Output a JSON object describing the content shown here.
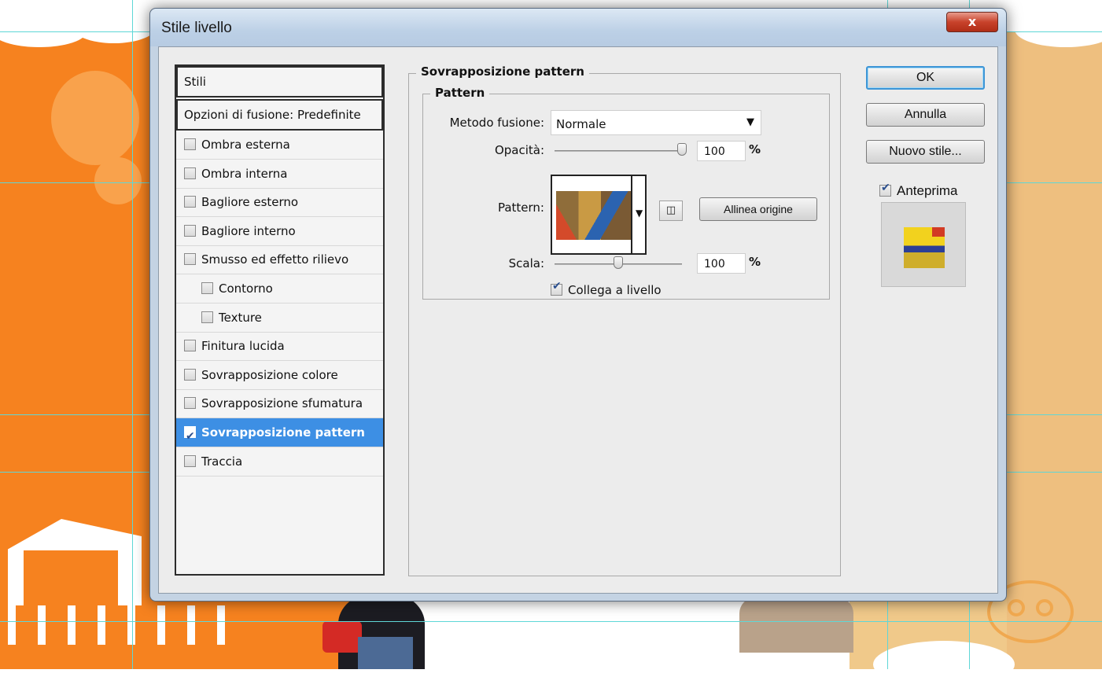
{
  "dialog": {
    "title": "Stile livello",
    "close_label": "x"
  },
  "styles_panel": {
    "header": "Stili",
    "blend_options": "Opzioni di fusione: Predefinite",
    "items": [
      {
        "label": "Ombra esterna",
        "checked": false
      },
      {
        "label": "Ombra interna",
        "checked": false
      },
      {
        "label": "Bagliore esterno",
        "checked": false
      },
      {
        "label": "Bagliore interno",
        "checked": false
      },
      {
        "label": "Smusso ed effetto rilievo",
        "checked": false
      },
      {
        "label": "Contorno",
        "checked": false,
        "sub": true
      },
      {
        "label": "Texture",
        "checked": false,
        "sub": true
      },
      {
        "label": "Finitura lucida",
        "checked": false
      },
      {
        "label": "Sovrapposizione colore",
        "checked": false
      },
      {
        "label": "Sovrapposizione sfumatura",
        "checked": false
      },
      {
        "label": "Sovrapposizione pattern",
        "checked": true,
        "selected": true
      },
      {
        "label": "Traccia",
        "checked": false
      }
    ]
  },
  "pattern_overlay": {
    "section_title": "Sovrapposizione pattern",
    "group_title": "Pattern",
    "blend_mode_label": "Metodo fusione:",
    "blend_mode_value": "Normale",
    "opacity_label": "Opacità:",
    "opacity_value": "100",
    "opacity_percent": 100,
    "percent_sign": "%",
    "pattern_label": "Pattern:",
    "snap_origin_label": "Allinea origine",
    "scale_label": "Scala:",
    "scale_value": "100",
    "scale_percent": 100,
    "link_label": "Collega a livello",
    "link_checked": true
  },
  "buttons": {
    "ok": "OK",
    "cancel": "Annulla",
    "new_style": "Nuovo stile...",
    "preview_label": "Anteprima",
    "preview_checked": true
  },
  "colors": {
    "selection": "#3d8fe4",
    "close_button": "#c8422b",
    "background_orange": "#f6821f"
  }
}
